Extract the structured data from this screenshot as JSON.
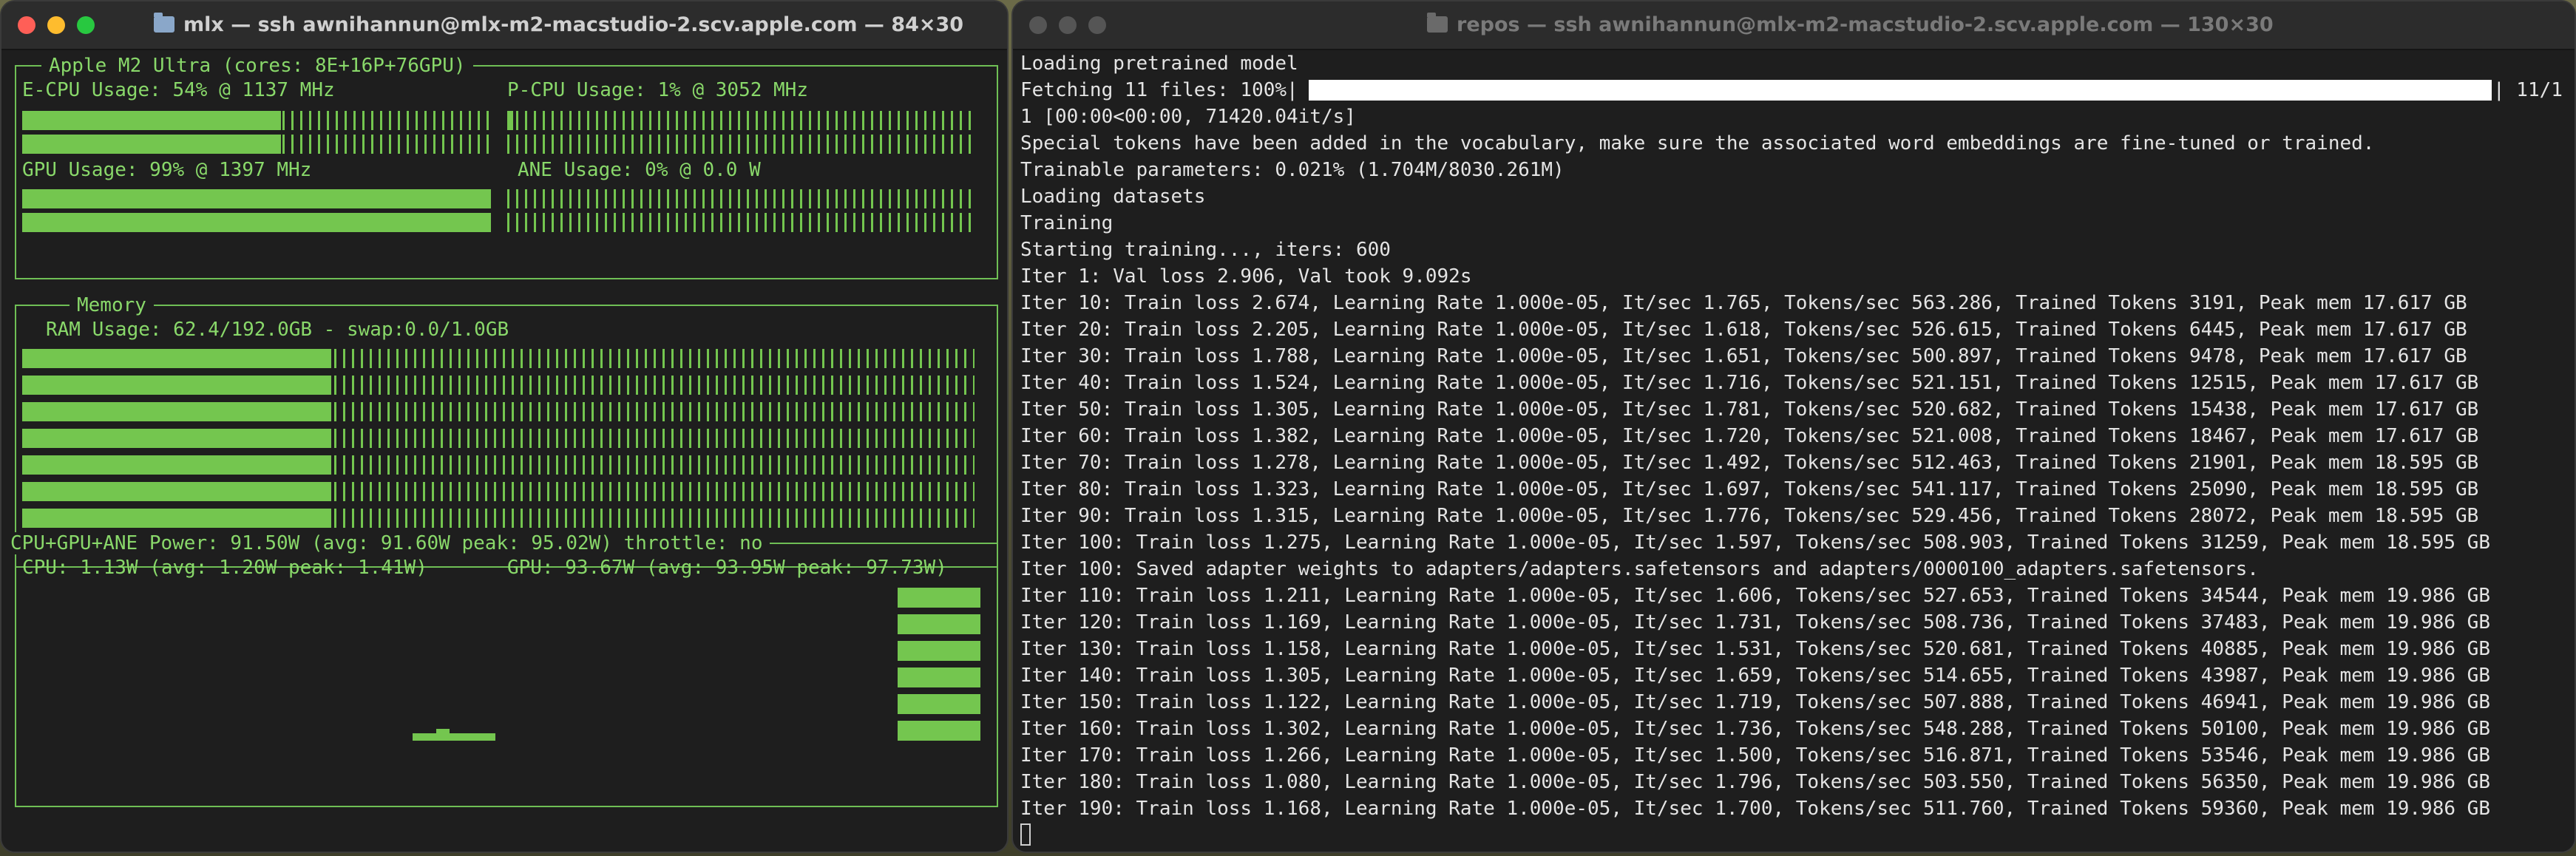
{
  "left_window": {
    "title": "mlx — ssh awnihannun@mlx-m2-macstudio-2.scv.apple.com — 84×30",
    "cpu_box_title": "Apple M2 Ultra (cores: 8E+16P+76GPU)",
    "ecpu_label": "E-CPU Usage: 54% @ 1137 MHz",
    "pcpu_label": "P-CPU Usage: 1% @ 3052 MHz",
    "gpu_label": "GPU Usage: 99% @ 1397 MHz",
    "ane_label": "ANE Usage: 0% @ 0.0 W",
    "memory_box_title": "Memory",
    "ram_label": "RAM Usage: 62.4/192.0GB - swap:0.0/1.0GB",
    "power_box_title": "CPU+GPU+ANE Power: 91.50W (avg: 91.60W peak: 95.02W) throttle: no",
    "cpu_power_label": "CPU: 1.13W (avg: 1.20W peak: 1.41W)",
    "gpu_power_label": "GPU: 93.67W (avg: 93.95W peak: 97.73W)",
    "ecpu_usage": 0.54,
    "pcpu_usage": 0.01,
    "gpu_usage": 0.99,
    "ane_usage": 0.0,
    "ram_usage": 0.325
  },
  "right_window": {
    "title": "repos — ssh awnihannun@mlx-m2-macstudio-2.scv.apple.com — 130×30",
    "fetch_prefix": "Fetching 11 files: 100%|",
    "fetch_suffix": "| 11/1",
    "fetch_progress": 1.0,
    "lines": [
      "Loading pretrained model",
      "1 [00:00<00:00, 71420.04it/s]",
      "Special tokens have been added in the vocabulary, make sure the associated word embeddings are fine-tuned or trained.",
      "Trainable parameters: 0.021% (1.704M/8030.261M)",
      "Loading datasets",
      "Training",
      "Starting training..., iters: 600",
      "Iter 1: Val loss 2.906, Val took 9.092s",
      "Iter 10: Train loss 2.674, Learning Rate 1.000e-05, It/sec 1.765, Tokens/sec 563.286, Trained Tokens 3191, Peak mem 17.617 GB",
      "Iter 20: Train loss 2.205, Learning Rate 1.000e-05, It/sec 1.618, Tokens/sec 526.615, Trained Tokens 6445, Peak mem 17.617 GB",
      "Iter 30: Train loss 1.788, Learning Rate 1.000e-05, It/sec 1.651, Tokens/sec 500.897, Trained Tokens 9478, Peak mem 17.617 GB",
      "Iter 40: Train loss 1.524, Learning Rate 1.000e-05, It/sec 1.716, Tokens/sec 521.151, Trained Tokens 12515, Peak mem 17.617 GB",
      "Iter 50: Train loss 1.305, Learning Rate 1.000e-05, It/sec 1.781, Tokens/sec 520.682, Trained Tokens 15438, Peak mem 17.617 GB",
      "Iter 60: Train loss 1.382, Learning Rate 1.000e-05, It/sec 1.720, Tokens/sec 521.008, Trained Tokens 18467, Peak mem 17.617 GB",
      "Iter 70: Train loss 1.278, Learning Rate 1.000e-05, It/sec 1.492, Tokens/sec 512.463, Trained Tokens 21901, Peak mem 18.595 GB",
      "Iter 80: Train loss 1.323, Learning Rate 1.000e-05, It/sec 1.697, Tokens/sec 541.117, Trained Tokens 25090, Peak mem 18.595 GB",
      "Iter 90: Train loss 1.315, Learning Rate 1.000e-05, It/sec 1.776, Tokens/sec 529.456, Trained Tokens 28072, Peak mem 18.595 GB",
      "Iter 100: Train loss 1.275, Learning Rate 1.000e-05, It/sec 1.597, Tokens/sec 508.903, Trained Tokens 31259, Peak mem 18.595 GB",
      "Iter 100: Saved adapter weights to adapters/adapters.safetensors and adapters/0000100_adapters.safetensors.",
      "Iter 110: Train loss 1.211, Learning Rate 1.000e-05, It/sec 1.606, Tokens/sec 527.653, Trained Tokens 34544, Peak mem 19.986 GB",
      "Iter 120: Train loss 1.169, Learning Rate 1.000e-05, It/sec 1.731, Tokens/sec 508.736, Trained Tokens 37483, Peak mem 19.986 GB",
      "Iter 130: Train loss 1.158, Learning Rate 1.000e-05, It/sec 1.531, Tokens/sec 520.681, Trained Tokens 40885, Peak mem 19.986 GB",
      "Iter 140: Train loss 1.305, Learning Rate 1.000e-05, It/sec 1.659, Tokens/sec 514.655, Trained Tokens 43987, Peak mem 19.986 GB",
      "Iter 150: Train loss 1.122, Learning Rate 1.000e-05, It/sec 1.719, Tokens/sec 507.888, Trained Tokens 46941, Peak mem 19.986 GB",
      "Iter 160: Train loss 1.302, Learning Rate 1.000e-05, It/sec 1.736, Tokens/sec 548.288, Trained Tokens 50100, Peak mem 19.986 GB",
      "Iter 170: Train loss 1.266, Learning Rate 1.000e-05, It/sec 1.500, Tokens/sec 516.871, Trained Tokens 53546, Peak mem 19.986 GB",
      "Iter 180: Train loss 1.080, Learning Rate 1.000e-05, It/sec 1.796, Tokens/sec 503.550, Trained Tokens 56350, Peak mem 19.986 GB",
      "Iter 190: Train loss 1.168, Learning Rate 1.000e-05, It/sec 1.700, Tokens/sec 511.760, Trained Tokens 59360, Peak mem 19.986 GB"
    ]
  }
}
